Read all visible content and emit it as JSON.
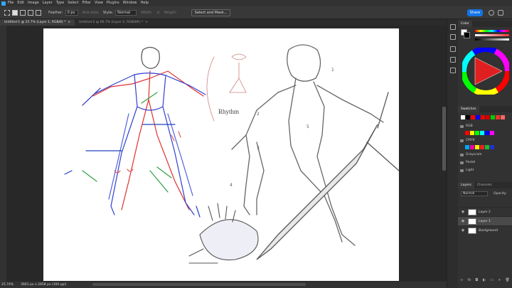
{
  "menubar": {
    "items": [
      "File",
      "Edit",
      "Image",
      "Layer",
      "Type",
      "Select",
      "Filter",
      "View",
      "Plugins",
      "Window",
      "Help"
    ]
  },
  "options": {
    "feather_label": "Feather:",
    "feather_value": "0 px",
    "antialias_label": "Anti-alias",
    "style_label": "Style:",
    "style_value": "Normal",
    "width_label": "Width:",
    "height_label": "Height:",
    "select_mask_label": "Select and Mask..."
  },
  "share_label": "Share",
  "tabs": [
    {
      "label": "Untitled-1 @ 25.7% (Layer 1, RGB/8) *",
      "active": true
    },
    {
      "label": "Untitled-2 @ 66.7% (Layer 2, RGB/8#) *",
      "active": false
    }
  ],
  "canvas_text": {
    "rhythm": "Rhythm",
    "n1": "1",
    "n2": "2",
    "n3": "3",
    "n4": "4",
    "n5": "5"
  },
  "status": {
    "zoom": "25.74%",
    "doc": "3661 px x 2858 px (300 ppi)"
  },
  "color_panel": {
    "tab": "Color"
  },
  "swatches_panel": {
    "tab": "Swatches",
    "groups": [
      "RGB",
      "CMYK",
      "Grayscale",
      "Pastel",
      "Light"
    ]
  },
  "layers_panel": {
    "tabs": [
      "Layers",
      "Channels"
    ],
    "kind_value": "Normal",
    "opacity_label": "Opacity:",
    "layers": [
      {
        "name": "Layer 2",
        "selected": false
      },
      {
        "name": "Layer 1",
        "selected": true
      },
      {
        "name": "Background",
        "selected": false
      }
    ]
  },
  "colors": {
    "accent": "#1473e6",
    "fg": "#ffffff",
    "bg": "#000000"
  }
}
